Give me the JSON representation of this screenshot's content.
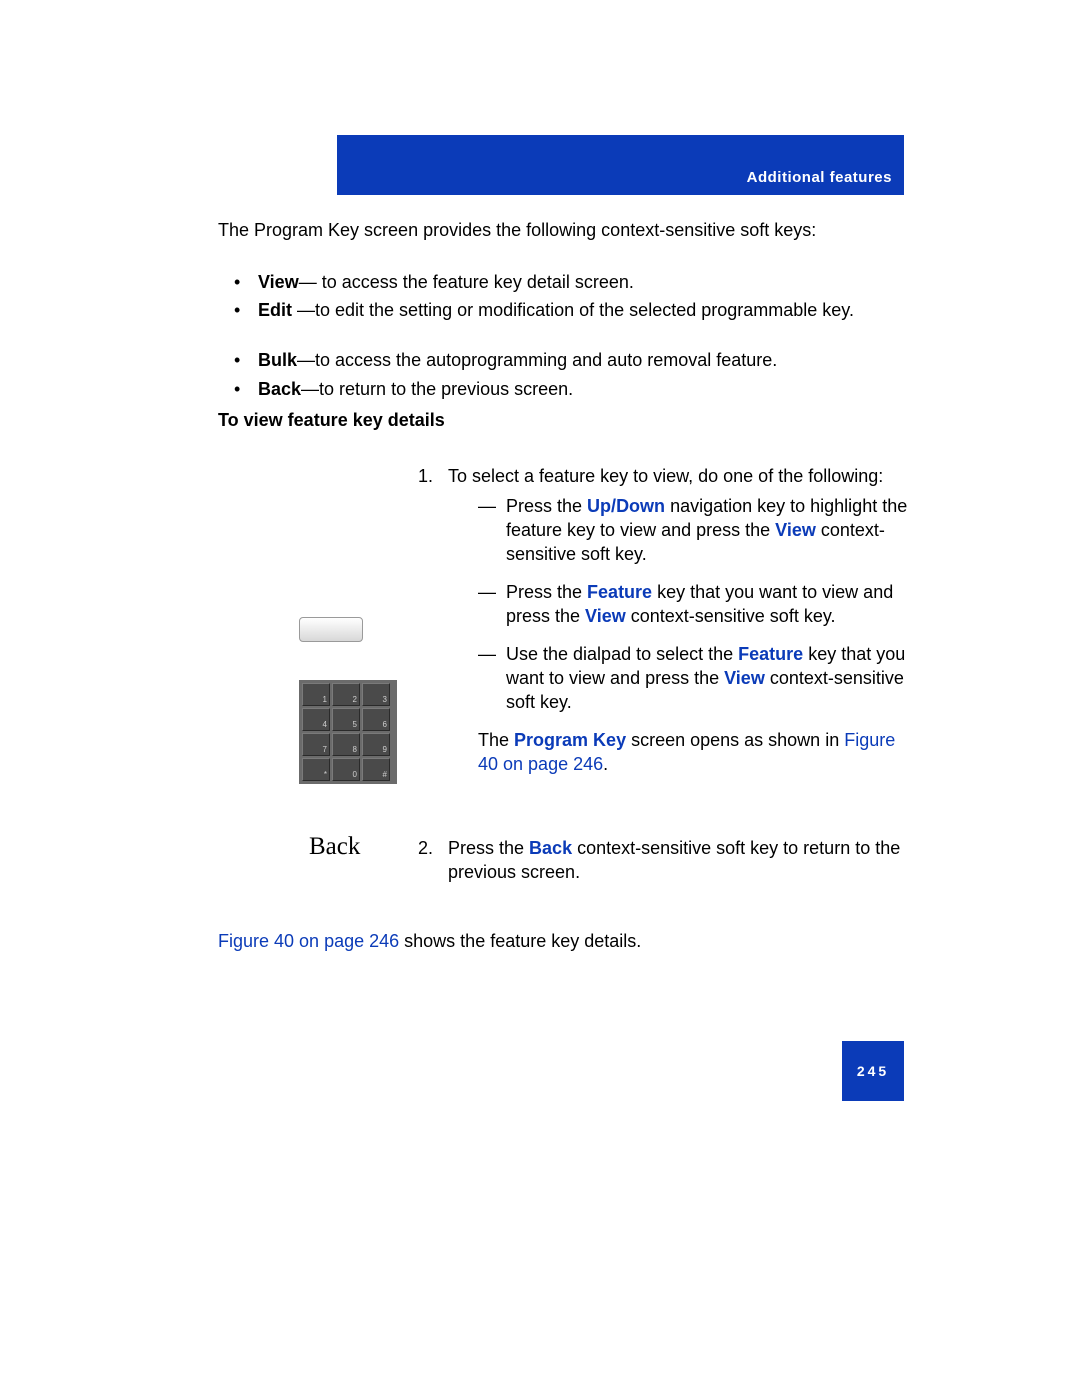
{
  "header": {
    "title": "Additional features"
  },
  "footer": {
    "page_number": "245"
  },
  "intro": "The Program Key screen provides the following context-sensitive soft keys:",
  "bullets": {
    "view": {
      "key": "View",
      "text": "— to access the feature key detail screen."
    },
    "edit": {
      "key": "Edit",
      "text": " —to edit the setting or modification of the selected programmable key."
    },
    "bulk": {
      "key": "Bulk",
      "text": "—to access the autoprogramming and auto removal feature."
    },
    "back": {
      "key": "Back",
      "text": "—to return to the previous screen."
    }
  },
  "section_title": "To view feature key details",
  "softkey_back_label": "Back",
  "step1": {
    "num": "1.",
    "lead": "To select a feature key to view, do one of the following:",
    "dash1_pre": "Press the ",
    "dash1_up": "Up",
    "dash1_slash": "/",
    "dash1_down": "Down",
    "dash1_mid": " navigation key to highlight the feature key to view and press the ",
    "dash1_view": "View",
    "dash1_post": " context-sensitive soft key.",
    "dash2_pre": "Press the ",
    "dash2_feature": "Feature",
    "dash2_mid": " key that you want to view and press the ",
    "dash2_view": "View",
    "dash2_post": " context-sensitive soft key.",
    "dash3_pre": "Use the dialpad to select the ",
    "dash3_feature": "Feature",
    "dash3_mid": " key that you want to view and press the ",
    "dash3_view": "View",
    "dash3_post": " context-sensitive soft key.",
    "pk_pre": "The ",
    "pk_bold": "Program Key",
    "pk_mid": " screen opens as shown in ",
    "pk_link": "Figure 40 on page 246",
    "pk_post": "."
  },
  "step2": {
    "num": "2.",
    "pre": "Press the ",
    "back": "Back",
    "post": " context-sensitive soft key to return to the previous screen."
  },
  "figref": {
    "link": "Figure 40 on page 246",
    "post": " shows the feature key details."
  },
  "dialpad": {
    "keys": [
      "1",
      "2",
      "3",
      "4",
      "5",
      "6",
      "7",
      "8",
      "9",
      "*",
      "0",
      "#"
    ]
  }
}
